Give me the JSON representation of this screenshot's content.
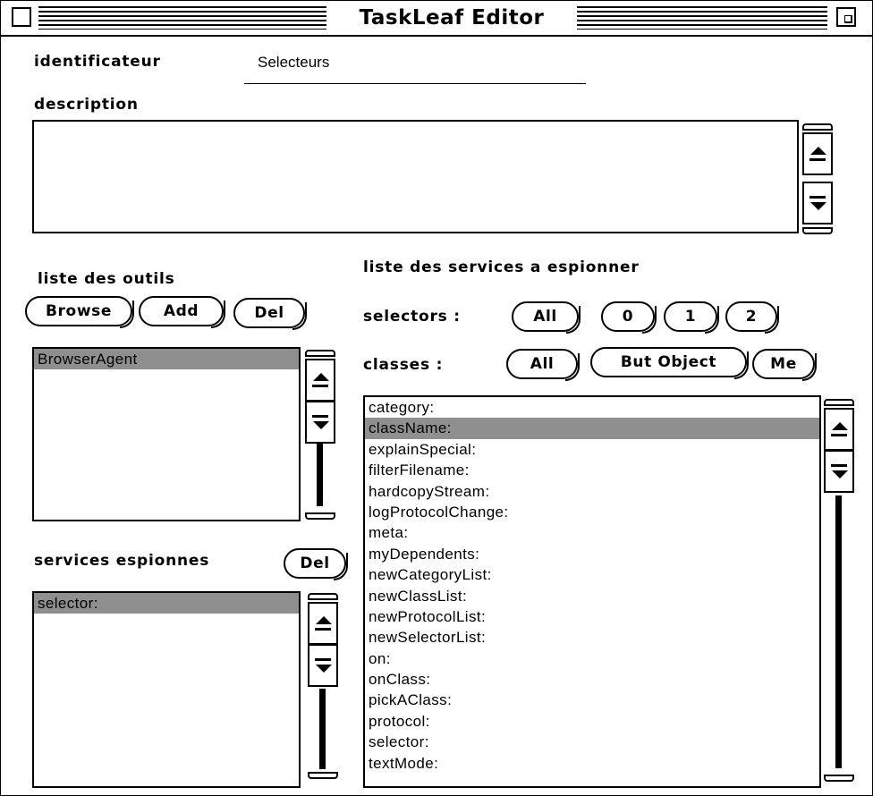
{
  "window": {
    "title": "TaskLeaf Editor"
  },
  "form": {
    "identifier_label": "identificateur",
    "identifier_value": "Selecteurs",
    "description_label": "description",
    "description_value": ""
  },
  "tools": {
    "label": "liste des outils",
    "browse_label": "Browse",
    "add_label": "Add",
    "del_label": "Del",
    "items": [
      "BrowserAgent"
    ],
    "selected_index": 0
  },
  "spied": {
    "label": "services espionnes",
    "del_label": "Del",
    "items": [
      "selector:"
    ],
    "selected_index": 0
  },
  "services": {
    "label": "liste des services a espionner",
    "selectors_label": "selectors :",
    "selectors_buttons": [
      "All",
      "0",
      "1",
      "2"
    ],
    "classes_label": "classes :",
    "classes_buttons": [
      "All",
      "But Object",
      "Me"
    ],
    "items": [
      "category:",
      "className:",
      "explainSpecial:",
      "filterFilename:",
      "hardcopyStream:",
      "logProtocolChange:",
      "meta:",
      "myDependents:",
      "newCategoryList:",
      "newClassList:",
      "newProtocolList:",
      "newSelectorList:",
      "on:",
      "onClass:",
      "pickAClass:",
      "protocol:",
      "selector:",
      "textMode:"
    ],
    "selected_index": 1
  }
}
